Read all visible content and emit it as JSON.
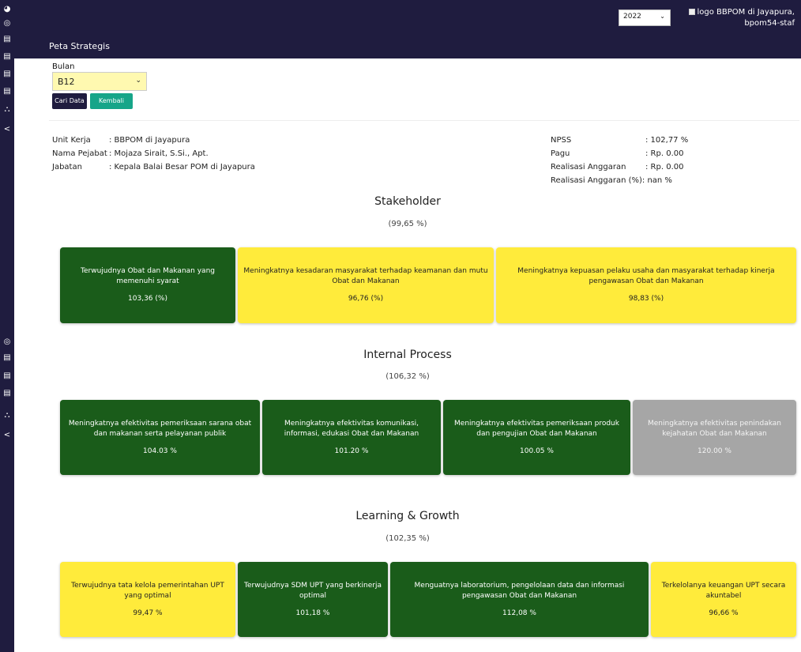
{
  "header": {
    "page_title": "Peta Strategis",
    "year_selected": "2022",
    "logo_alt": "logo BBPOM di Jayapura,",
    "user": "bpom54-staf"
  },
  "filter": {
    "bulan_label": "Bulan",
    "bulan_selected": "B12",
    "cari_label": "Cari Data",
    "kembali_label": "Kembali"
  },
  "info_left": [
    {
      "key": "Unit Kerja",
      "value": ": BBPOM di Jayapura"
    },
    {
      "key": "Nama Pejabat",
      "value": ": Mojaza Sirait, S.Si., Apt."
    },
    {
      "key": "Jabatan",
      "value": ": Kepala Balai Besar POM di Jayapura"
    }
  ],
  "info_right": [
    {
      "key": "NPSS",
      "value": ": 102,77 %"
    },
    {
      "key": "Pagu",
      "value": ": Rp. 0.00"
    },
    {
      "key": "Realisasi Anggaran",
      "value": ": Rp. 0.00"
    },
    {
      "key": "Realisasi Anggaran (%)",
      "value": ": nan %"
    }
  ],
  "sections": [
    {
      "title": "Stakeholder",
      "pct": "(99,65 %)",
      "cards": [
        {
          "text": "Terwujudnya Obat dan Makanan yang memenuhi syarat",
          "pct": "103,36 (%)",
          "color": "#1a5c1a"
        },
        {
          "text": "Meningkatnya kesadaran masyarakat terhadap keamanan dan mutu Obat dan Makanan",
          "pct": "96,76 (%)",
          "color": "#ffeb3b"
        },
        {
          "text": "Meningkatnya kepuasan pelaku usaha dan masyarakat terhadap kinerja pengawasan Obat dan Makanan",
          "pct": "98,83 (%)",
          "color": "#ffeb3b"
        }
      ]
    },
    {
      "title": "Internal Process",
      "pct": "(106,32 %)",
      "cards": [
        {
          "text": "Meningkatnya efektivitas pemeriksaan sarana obat dan makanan serta pelayanan publik",
          "pct": "104.03 %",
          "color": "#1a5c1a"
        },
        {
          "text": "Meningkatnya efektivitas komunikasi, informasi, edukasi Obat dan Makanan",
          "pct": "101.20 %",
          "color": "#1a5c1a"
        },
        {
          "text": "Meningkatnya efektivitas pemeriksaan produk dan pengujian Obat dan Makanan",
          "pct": "100.05 %",
          "color": "#1a5c1a"
        },
        {
          "text": "Meningkatnya efektivitas penindakan kejahatan Obat dan Makanan",
          "pct": "120.00 %",
          "color": "#a6a6a6"
        }
      ]
    },
    {
      "title": "Learning & Growth",
      "pct": "(102,35 %)",
      "cards": [
        {
          "text": "Terwujudnya tata kelola pemerintahan UPT yang optimal",
          "pct": "99,47 %",
          "color": "#ffeb3b"
        },
        {
          "text": "Terwujudnya SDM UPT yang berkinerja optimal",
          "pct": "101,18 %",
          "color": "#1a5c1a"
        },
        {
          "text": "Menguatnya laboratorium, pengelolaan data dan informasi pengawasan Obat dan Makanan",
          "pct": "112,08 %",
          "color": "#1a5c1a"
        },
        {
          "text": "Terkelolanya keuangan UPT secara akuntabel",
          "pct": "96,66 %",
          "color": "#ffeb3b"
        }
      ]
    }
  ]
}
